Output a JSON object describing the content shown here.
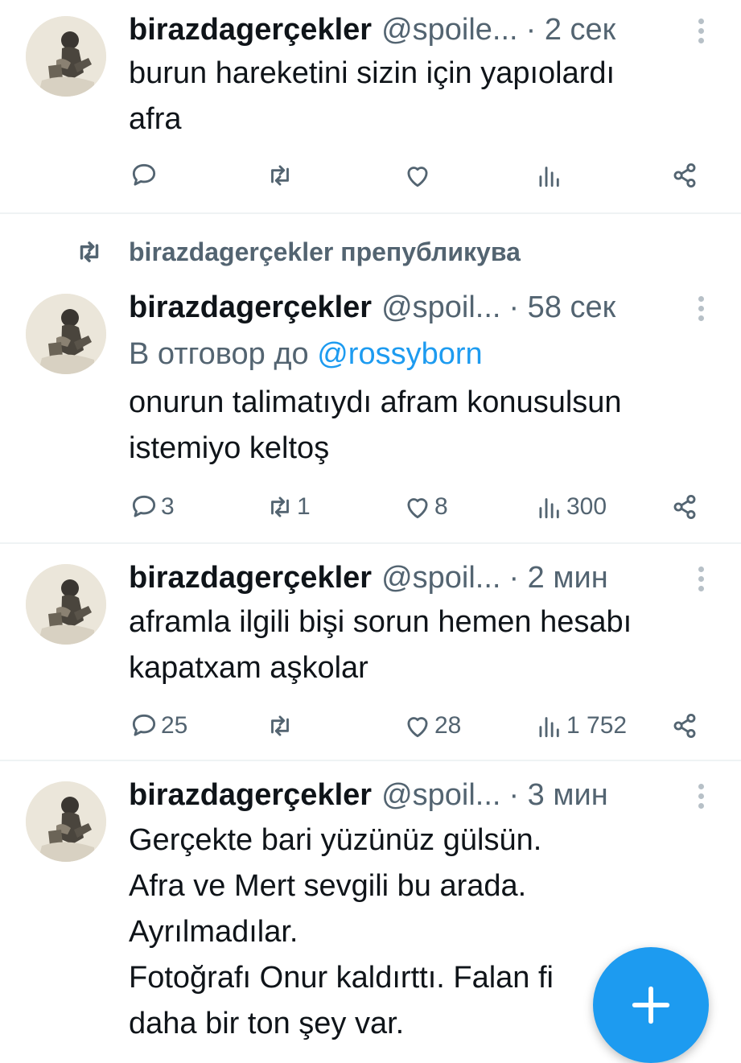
{
  "tweets": [
    {
      "author": "birazdagerçekler",
      "handle": "@spoile...",
      "time": "· 2 сек",
      "reply_prefix": "",
      "reply_mention": "",
      "lines": [
        "burun hareketini sizin için yapıolardı",
        "afra"
      ],
      "stats": {
        "replies": "",
        "retweets": "",
        "likes": "",
        "views": ""
      }
    },
    {
      "author": "birazdagerçekler",
      "handle": "@spoil...",
      "time": "· 58 сек",
      "reply_prefix": "В отговор до ",
      "reply_mention": "@rossyborn",
      "lines": [
        "onurun talimatıydı afram konusulsun",
        "istemiyo keltoş"
      ],
      "stats": {
        "replies": "3",
        "retweets": "1",
        "likes": "8",
        "views": "300"
      }
    },
    {
      "author": "birazdagerçekler",
      "handle": "@spoil...",
      "time": "· 2 мин",
      "reply_prefix": "",
      "reply_mention": "",
      "lines": [
        "aframla ilgili bişi sorun hemen hesabı",
        "kapatxam aşkolar"
      ],
      "stats": {
        "replies": "25",
        "retweets": "",
        "likes": "28",
        "views": "1 752"
      }
    },
    {
      "author": "birazdagerçekler",
      "handle": "@spoil...",
      "time": "· 3 мин",
      "reply_prefix": "",
      "reply_mention": "",
      "lines": [
        "Gerçekte bari yüzünüz gülsün.",
        "Afra ve Mert sevgili bu arada.",
        "Ayrılmadılar.",
        "Fotoğrafı Onur kaldırttı. Falan fi",
        "daha bir ton şey var."
      ],
      "stats": {
        "replies": "",
        "retweets": "",
        "likes": "",
        "views": ""
      }
    }
  ],
  "retweet_banner": {
    "user": "birazdagerçekler",
    "action": "препубликува"
  },
  "icons": [
    "reply-icon",
    "retweet-icon",
    "like-icon",
    "views-icon",
    "share-icon",
    "more-icon",
    "compose-plus-icon"
  ],
  "colors": {
    "text": "#0f1419",
    "secondary": "#536471",
    "accent": "#1d9bf0",
    "divider": "#eff3f4"
  }
}
